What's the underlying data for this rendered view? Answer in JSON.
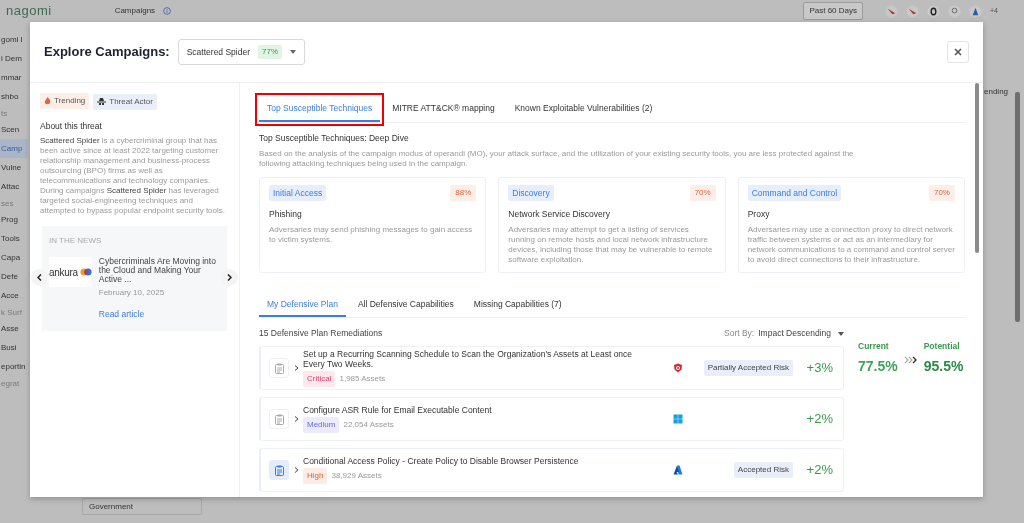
{
  "background": {
    "logo": "nagomi",
    "page_title": "Campaigns",
    "date_range": "Past 60 Days",
    "more_count": "+4",
    "sort_fragment": "ending",
    "field_text": "Government",
    "sidebar": [
      {
        "label": "gomi I",
        "kind": "item",
        "selected": false
      },
      {
        "label": "i Dem",
        "kind": "item",
        "selected": false
      },
      {
        "label": "mmar",
        "kind": "item",
        "selected": false
      },
      {
        "label": "shbo",
        "kind": "item",
        "selected": false
      },
      {
        "label": "ts",
        "kind": "section",
        "selected": false
      },
      {
        "label": "Scen",
        "kind": "item",
        "selected": false
      },
      {
        "label": "Camp",
        "kind": "item",
        "selected": true
      },
      {
        "label": "Vulne",
        "kind": "item",
        "selected": false
      },
      {
        "label": "Attac",
        "kind": "item",
        "selected": false
      },
      {
        "label": "ses",
        "kind": "section",
        "selected": false
      },
      {
        "label": "Prog",
        "kind": "item",
        "selected": false
      },
      {
        "label": "Tools",
        "kind": "item",
        "selected": false
      },
      {
        "label": "Capa",
        "kind": "item",
        "selected": false
      },
      {
        "label": "Defe",
        "kind": "item",
        "selected": false
      },
      {
        "label": "Acce",
        "kind": "item",
        "selected": false
      },
      {
        "label": "k Surf",
        "kind": "section",
        "selected": false
      },
      {
        "label": "Asse",
        "kind": "item",
        "selected": false
      },
      {
        "label": "Busi",
        "kind": "item",
        "selected": false
      },
      {
        "label": "eportin",
        "kind": "item",
        "selected": false
      },
      {
        "label": "egrat",
        "kind": "section",
        "selected": false
      }
    ]
  },
  "modal": {
    "title": "Explore Campaigns:",
    "campaign": {
      "name": "Scattered Spider",
      "score": "77%"
    },
    "tags": [
      {
        "label": "Trending",
        "kind": "trending"
      },
      {
        "label": "Threat Actor",
        "kind": "actor"
      }
    ],
    "about_heading": "About this threat",
    "about_text": "**Scattered Spider** is a cybercriminal group that has been active since at least 2022 targeting customer relationship management and business-process outsourcing (BPO) firms as well as telecommunications and technology companies. During campaigns **Scattered Spider** has leveraged targeted social-engineering techniques and attempted to bypass popular endpoint security tools.",
    "news": {
      "heading": "IN THE NEWS",
      "source": "ankura",
      "headline": "Cybercriminals Are Moving into the Cloud and Making Your Active ...",
      "date": "February 10, 2025",
      "link": "Read article"
    },
    "tabs": [
      {
        "label": "Top Susceptible Techniques",
        "selected": true,
        "highlighted": true
      },
      {
        "label": "MITRE ATT&CK® mapping",
        "selected": false,
        "highlighted": false
      },
      {
        "label": "Known Exploitable Vulnerabilities (2)",
        "selected": false,
        "highlighted": false
      }
    ],
    "deep_dive": {
      "title": "Top Susceptible Techniques: Deep Dive",
      "description": "Based on the analysis of the campaign modus of operandi (MO), your attack surface, and the utilization of your existing security tools, you are less protected against the following attacking techniques being used in the campaign."
    },
    "techniques": [
      {
        "tactic": "Initial Access",
        "score": "88%",
        "name": "Phishing",
        "description": "Adversaries may send phishing messages to gain access to victim systems."
      },
      {
        "tactic": "Discovery",
        "score": "70%",
        "name": "Network Service Discovery",
        "description": "Adversaries may attempt to get a listing of services running on remote hosts and local network infrastructure devices, including those that may be vulnerable to remote software exploitation."
      },
      {
        "tactic": "Command and Control",
        "score": "70%",
        "name": "Proxy",
        "description": "Adversaries may use a connection proxy to direct network traffic between systems or act as an intermediary for network communications to a command and control server to avoid direct connections to their infrastructure."
      }
    ],
    "plan_tabs": [
      {
        "label": "My Defensive Plan",
        "selected": true
      },
      {
        "label": "All Defensive Capabilities",
        "selected": false
      },
      {
        "label": "Missing Capabilities (7)",
        "selected": false
      }
    ],
    "remediation_count": "15 Defensive Plan Remediations",
    "sort": {
      "label": "Sort By:",
      "value": "Impact Descending"
    },
    "remediations": [
      {
        "title": "Set up a Recurring Scanning Schedule to Scan the Organization's Assets at Least once Every Two Weeks.",
        "severity": "Critical",
        "assets": "1,985 Assets",
        "kind": "shield",
        "status": "Partially Accepted Risk",
        "impact": "+3%",
        "icon_highlighted": false
      },
      {
        "title": "Configure ASR Rule for Email Executable Content",
        "severity": "Medium",
        "assets": "22,054 Assets",
        "kind": "windows",
        "impact": "+2%",
        "icon_highlighted": false
      },
      {
        "title": "Conditional Access Policy - Create Policy to Disable Browser Persistence",
        "severity": "High",
        "assets": "38,929 Assets",
        "kind": "azure",
        "status": "Accepted Risk",
        "impact": "+2%",
        "icon_highlighted": true
      }
    ],
    "current": {
      "label": "Current",
      "value": "77.5%"
    },
    "potential": {
      "label": "Potential",
      "value": "95.5%"
    }
  }
}
